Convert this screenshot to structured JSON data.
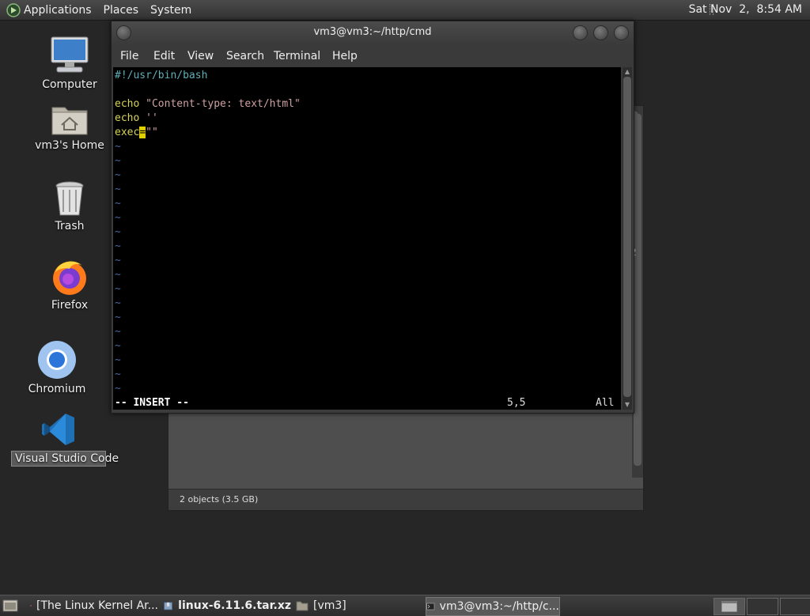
{
  "top_panel": {
    "menus": [
      "Applications",
      "Places",
      "System"
    ],
    "clock": "Sat Nov  2,  8:54 AM"
  },
  "desktop_icons": [
    {
      "label": "Computer",
      "icon": "computer-icon"
    },
    {
      "label": "vm3's Home",
      "icon": "home-folder-icon"
    },
    {
      "label": "Trash",
      "icon": "trash-icon"
    },
    {
      "label": "Firefox",
      "icon": "firefox-icon"
    },
    {
      "label": "Chromium",
      "icon": "chromium-icon"
    },
    {
      "label": "Visual Studio Code",
      "icon": "vscode-icon",
      "selected": true
    }
  ],
  "file_manager": {
    "status": "2 objects (3.5 GB)",
    "partial_text": "2"
  },
  "terminal": {
    "title": "vm3@vm3:~/http/cmd",
    "menu": [
      "File",
      "Edit",
      "View",
      "Search",
      "Terminal",
      "Help"
    ],
    "lines": {
      "shebang": "#!/usr/bin/bash",
      "echo1_kw": "echo",
      "echo1_str": "\"Content-type: text/html\"",
      "echo2_kw": "echo",
      "echo2_str": "''",
      "exec_kw": "exec",
      "exec_cursor": "=",
      "exec_str": "\"\""
    },
    "tilde": "~",
    "tilde_count": 18,
    "status_mode": "-- INSERT --",
    "status_pos": "5,5",
    "status_scroll": "All",
    "colors": {
      "shebang": "#5fb0b8",
      "keyword": "#d8d35a",
      "string": "#d0a2a2",
      "tilde": "#4d6a9c",
      "cursor": "#e0d000"
    }
  },
  "taskbar": {
    "tasks": [
      {
        "label": "[The Linux Kernel Ar...",
        "icon": "firefox-icon"
      },
      {
        "label": "linux-6.11.6.tar.xz",
        "icon": "archive-icon",
        "bold": true
      },
      {
        "label": "[vm3]",
        "icon": "folder-icon"
      },
      {
        "label": "vm3@vm3:~/http/c...",
        "icon": "terminal-icon",
        "active": true
      }
    ]
  }
}
